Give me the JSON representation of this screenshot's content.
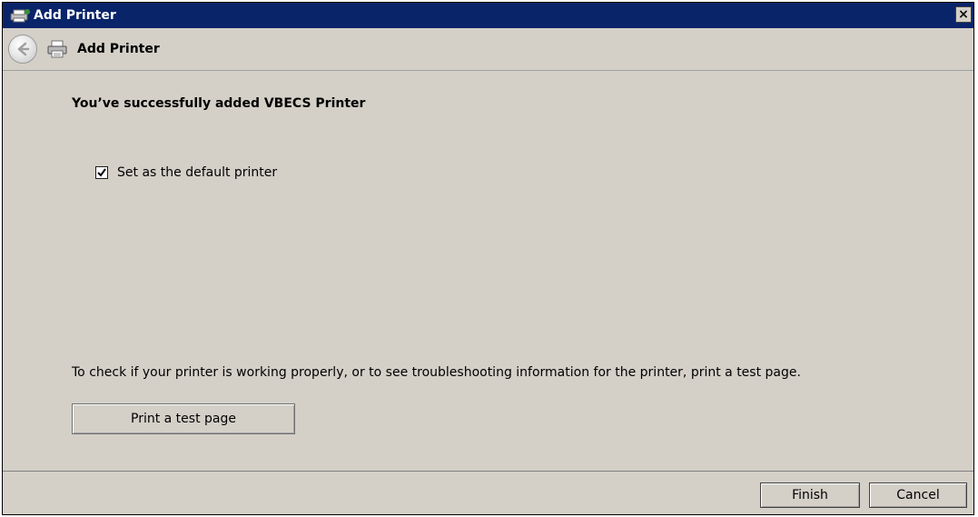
{
  "window": {
    "title": "Add Printer",
    "close_label": "×"
  },
  "nav": {
    "title": "Add Printer",
    "back_icon": "back-arrow-icon",
    "printer_icon": "printer-icon"
  },
  "content": {
    "success_message": "You’ve successfully added VBECS Printer",
    "default_checkbox": {
      "label": "Set as the default printer",
      "checked": true
    },
    "info_text": "To check if your printer is working properly, or to see troubleshooting information for the printer, print a test page.",
    "test_page_button": "Print a test page"
  },
  "footer": {
    "finish_label": "Finish",
    "cancel_label": "Cancel"
  },
  "colors": {
    "titlebar": "#0a246a",
    "window_bg": "#d4d0c8"
  }
}
